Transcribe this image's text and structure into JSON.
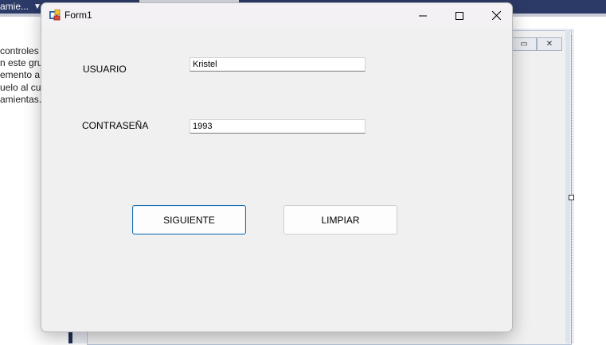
{
  "ide": {
    "tab_label": "amie...",
    "left_panel_lines": [
      "controles",
      "n este gru",
      "emento a",
      "uelo al cu",
      "amientas."
    ]
  },
  "form": {
    "title": "Form1",
    "usuario_label": "USUARIO",
    "usuario_value": "Kristel",
    "password_label": "CONTRASEÑA",
    "password_value": "1993",
    "siguiente_label": "SIGUIENTE",
    "limpiar_label": "LIMPIAR"
  }
}
